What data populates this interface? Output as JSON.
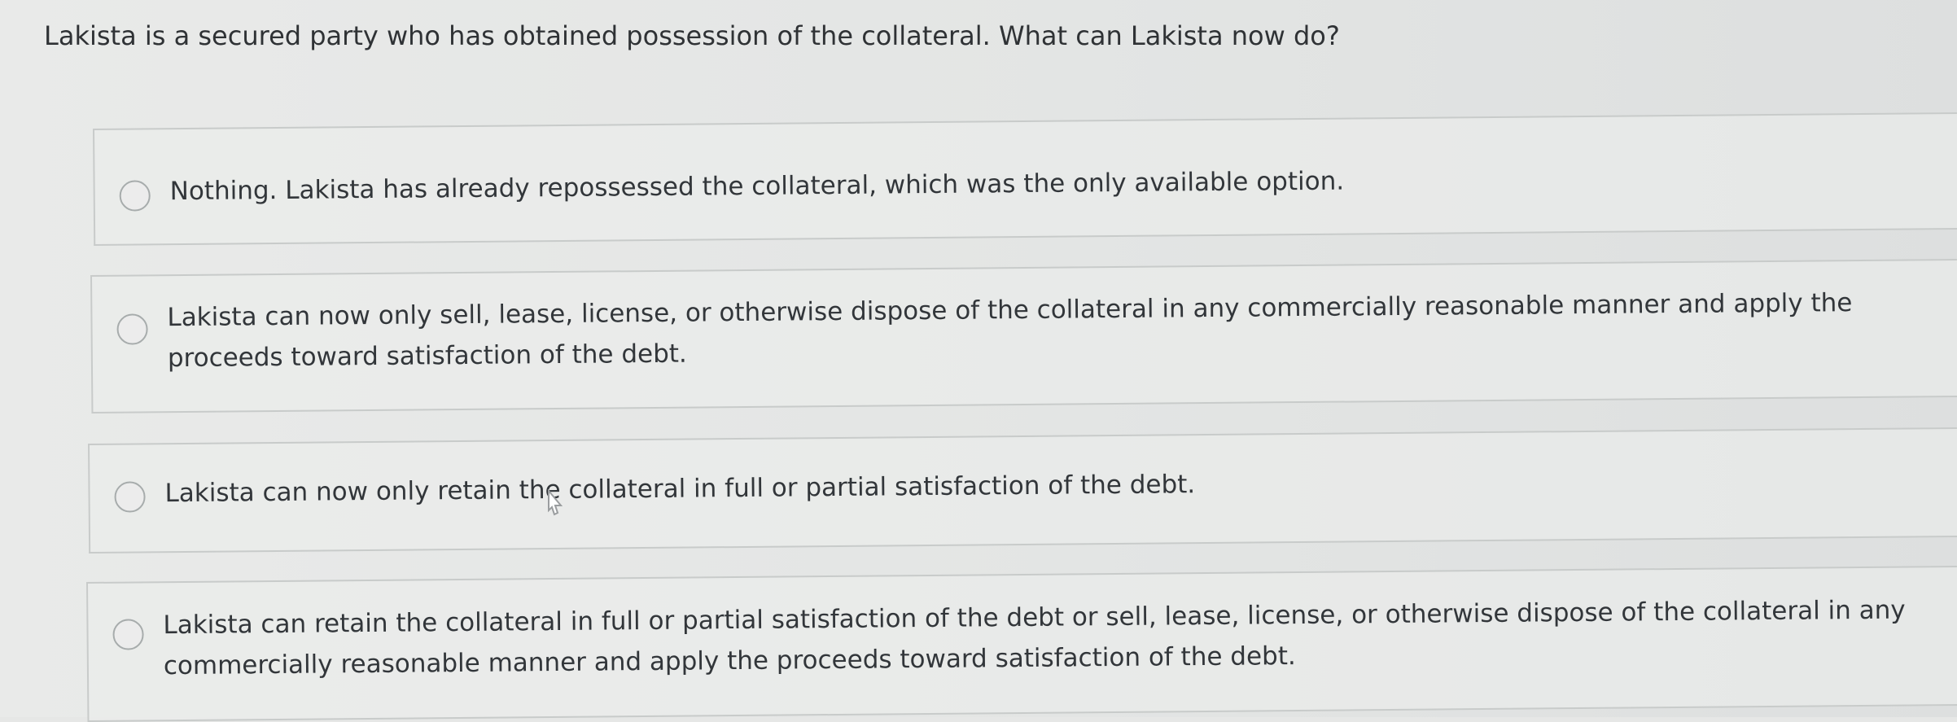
{
  "question": {
    "text": "Lakista is a secured party who has obtained possession of the collateral. What can Lakista now do?"
  },
  "options": [
    {
      "text": "Nothing. Lakista has already repossessed the collateral, which was the only available option."
    },
    {
      "text": "Lakista can now only sell, lease, license, or otherwise dispose of the collateral in any commercially reasonable manner and apply the proceeds toward satisfaction of the debt."
    },
    {
      "text": "Lakista can now only retain the collateral in full or partial satisfaction of the debt."
    },
    {
      "text": "Lakista can retain the collateral in full or partial satisfaction of the debt or sell, lease, license, or otherwise dispose of the collateral in any commercially reasonable manner and apply the proceeds toward satisfaction of the debt."
    }
  ]
}
